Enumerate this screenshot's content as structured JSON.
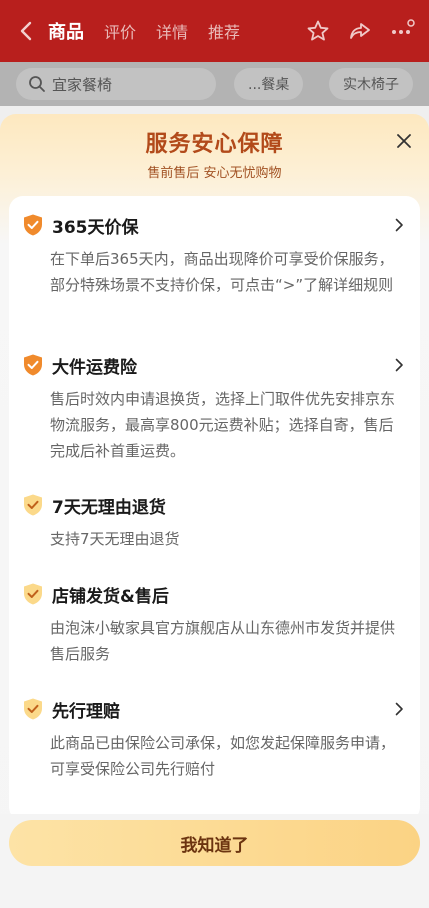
{
  "nav": {
    "tabs": [
      "商品",
      "评价",
      "详情",
      "推荐"
    ],
    "active_tab": 0
  },
  "search": {
    "value": "宜家餐椅",
    "chips": [
      "...餐桌",
      "实木椅子"
    ]
  },
  "sheet": {
    "title": "服务安心保障",
    "subtitle": "售前售后 安心无忧购物",
    "items": [
      {
        "title": "365天价保",
        "desc": "在下单后365天内，商品出现降价可享受价保服务，部分特殊场景不支持价保，可点击“>”了解详细规则",
        "has_arrow": true,
        "icon": "shield-check-icon"
      },
      {
        "title": "大件运费险",
        "desc": "售后时效内申请退换货，选择上门取件优先安排京东物流服务，最高享800元运费补贴；选择自寄，售后完成后补首重运费。",
        "has_arrow": true,
        "icon": "shield-check-icon"
      },
      {
        "title": "7天无理由退货",
        "desc": "支持7天无理由退货",
        "has_arrow": false,
        "icon": "shield-check-icon"
      },
      {
        "title": "店铺发货&售后",
        "desc": "由泡沫小敏家具官方旗舰店从山东德州市发货并提供售后服务",
        "has_arrow": false,
        "icon": "shield-check-icon"
      },
      {
        "title": "先行理赔",
        "desc": "此商品已由保险公司承保，如您发起保障服务申请，可享受保险公司先行赔付",
        "has_arrow": true,
        "icon": "shield-check-icon"
      }
    ],
    "confirm_label": "我知道了"
  },
  "colors": {
    "nav_red": "#b81f1d",
    "title_brown": "#b24a1a",
    "shield_orange": "#f08a2c",
    "shield_light": "#f9c46b",
    "button_gold": "#fbd384"
  }
}
